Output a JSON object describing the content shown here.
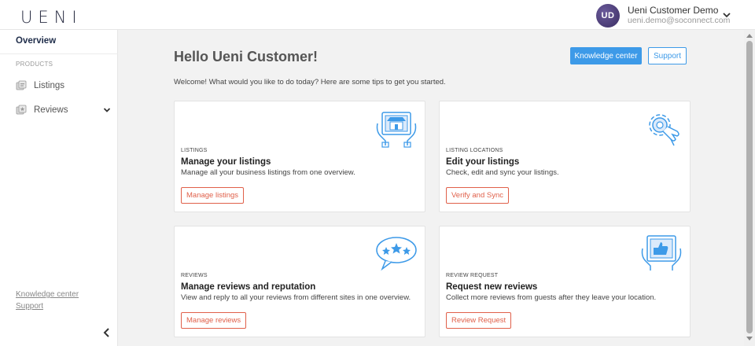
{
  "app": {
    "logo": "UENI"
  },
  "user": {
    "initials": "UD",
    "name": "Ueni Customer Demo",
    "email": "ueni.demo@soconnect.com"
  },
  "sidebar": {
    "overview": "Overview",
    "section_label": "PRODUCTS",
    "items": [
      {
        "label": "Listings",
        "icon": "listings-icon"
      },
      {
        "label": "Reviews",
        "icon": "reviews-icon"
      }
    ],
    "footer_links": [
      "Knowledge center",
      "Support"
    ]
  },
  "main": {
    "greeting": "Hello Ueni Customer!",
    "welcome": "Welcome! What would you like to do today? Here are some tips to get you started.",
    "header_buttons": {
      "knowledge": "Knowledge center",
      "support": "Support"
    },
    "cards": [
      {
        "kicker": "LISTINGS",
        "title": "Manage your listings",
        "desc": "Manage all your business listings from one overview.",
        "action": "Manage listings",
        "icon": "storefront-tablet-icon"
      },
      {
        "kicker": "LISTING LOCATIONS",
        "title": "Edit your listings",
        "desc": "Check, edit and sync your listings.",
        "action": "Verify and Sync",
        "icon": "gear-hand-icon"
      },
      {
        "kicker": "REVIEWS",
        "title": "Manage reviews and reputation",
        "desc": "View and reply to all your reviews from different sites in one overview.",
        "action": "Manage reviews",
        "icon": "stars-speech-bubble-icon"
      },
      {
        "kicker": "REVIEW REQUEST",
        "title": "Request new reviews",
        "desc": "Collect more reviews from guests after they leave your location.",
        "action": "Review Request",
        "icon": "thumbs-up-tablet-icon"
      }
    ]
  },
  "colors": {
    "accent_blue": "#3d9ae8",
    "action_red": "#e0604a",
    "avatar_purple": "#4a3c78"
  }
}
